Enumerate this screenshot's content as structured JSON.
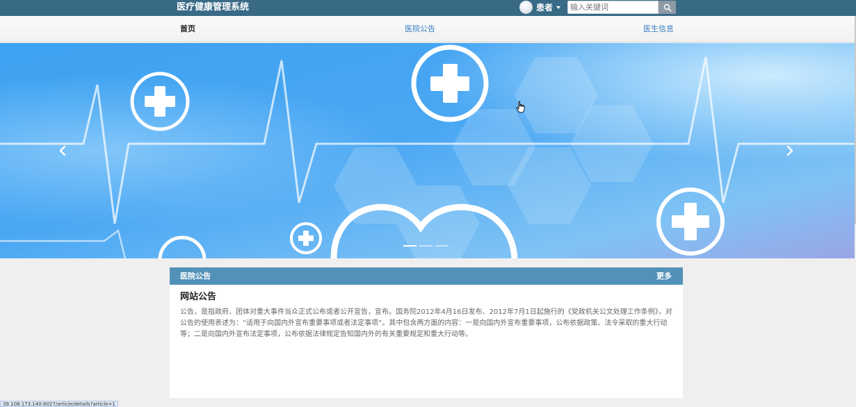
{
  "header": {
    "title": "医疗健康管理系统",
    "user_label": "患者",
    "search": {
      "placeholder": "输入关键词",
      "value": ""
    }
  },
  "nav": {
    "items": [
      {
        "label": "首页",
        "active": true
      },
      {
        "label": "医院公告",
        "active": false
      },
      {
        "label": "医生信息",
        "active": false
      }
    ]
  },
  "carousel": {
    "slide_count": 3,
    "active_index": 0
  },
  "notice_panel": {
    "header_title": "医院公告",
    "more_label": "更多",
    "article": {
      "title": "网站公告",
      "body": "公告，是指政府、团体对重大事件当众正式公布或者公开宣告，宣布。国务院2012年4月16日发布、2012年7月1日起施行的《党政机关公文处理工作条例》，对公告的使用表述为：“适用于向国内外宣布重要事项或者法定事项”。其中包含两方面的内容：一是向国内外宣布重要事项，公布依据政策、法令采取的重大行动等；二是向国内外宣布法定事项，公布依据法律规定告知国内外的有关重要规定和重大行动等。"
    }
  },
  "status_bar": {
    "url": "39.108.173.140:8027/article/details?article=1"
  },
  "icons": {
    "search": "search-icon",
    "caret": "caret-down-icon",
    "prev": "chevron-left-icon",
    "next": "chevron-right-icon",
    "cursor": "hand-cursor-icon"
  },
  "colors": {
    "topbar": "#386a86",
    "panel_header": "#5292b9",
    "nav_link": "#3a7dc4"
  }
}
